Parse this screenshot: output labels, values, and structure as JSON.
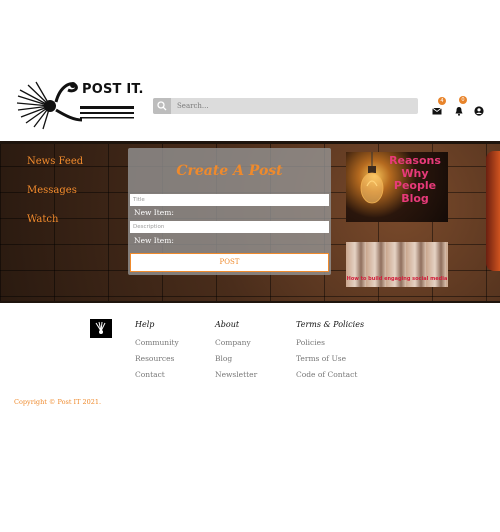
{
  "header": {
    "brand": "POST IT.",
    "search_placeholder": "Search...",
    "mail_badge": "4",
    "bell_badge": "0"
  },
  "nav": {
    "items": [
      "News Feed",
      "Messages",
      "Watch"
    ]
  },
  "post_card": {
    "title": "Create A Post",
    "title_placeholder": "Title",
    "item_label_1": "New Item:",
    "description_placeholder": "Description",
    "item_label_2": "New Item:",
    "post_label": "POST"
  },
  "ads": {
    "ad1_text": "Reasons Why People Blog",
    "ad2_text": "How to build engaging social media"
  },
  "footer": {
    "help": {
      "heading": "Help",
      "links": [
        "Community",
        "Resources",
        "Contact"
      ]
    },
    "about": {
      "heading": "About",
      "links": [
        "Company",
        "Blog",
        "Newsletter"
      ]
    },
    "terms": {
      "heading": "Terms & Policies",
      "links": [
        "Policies",
        "Terms of Use",
        "Code of Contact"
      ]
    },
    "copyright": "Copyright © Post IT 2021."
  },
  "colors": {
    "accent": "#ef8a2c",
    "badge": "#e8842b",
    "search_bg": "#dcdcdc"
  }
}
